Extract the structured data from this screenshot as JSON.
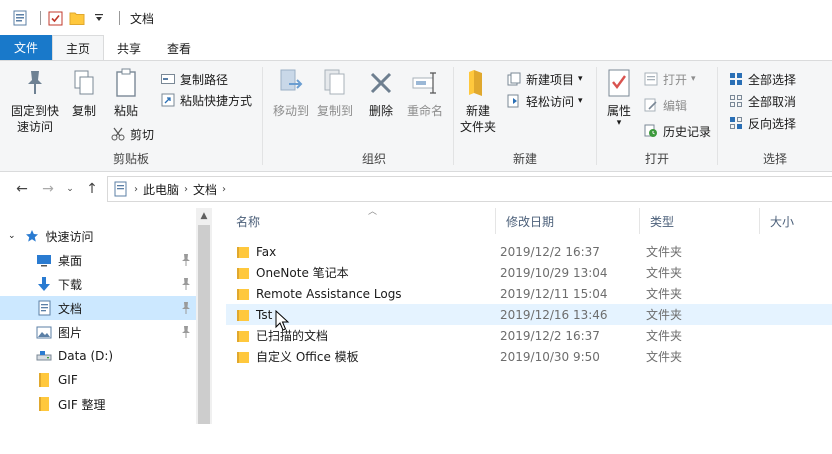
{
  "window": {
    "title": "文档"
  },
  "ribbon_tabs": [
    "文件",
    "主页",
    "共享",
    "查看"
  ],
  "ribbon": {
    "clipboard": {
      "label": "剪贴板",
      "pin_quick_access": "固定到快\n速访问",
      "copy": "复制",
      "paste": "粘贴",
      "copy_path": "复制路径",
      "paste_shortcut": "粘贴快捷方式",
      "cut": "剪切"
    },
    "organize": {
      "label": "组织",
      "move_to": "移动到",
      "copy_to": "复制到",
      "delete": "删除",
      "rename": "重命名"
    },
    "new": {
      "label": "新建",
      "new_folder": "新建\n文件夹",
      "new_item": "新建项目",
      "easy_access": "轻松访问"
    },
    "open": {
      "label": "打开",
      "properties": "属性",
      "open": "打开",
      "edit": "编辑",
      "history": "历史记录"
    },
    "select": {
      "label": "选择",
      "select_all": "全部选择",
      "select_none": "全部取消",
      "invert": "反向选择"
    }
  },
  "address": {
    "crumbs": [
      "此电脑",
      "文档"
    ]
  },
  "nav_pane": {
    "items": [
      {
        "label": "快速访问",
        "icon": "star-icon"
      },
      {
        "label": "桌面",
        "icon": "desktop-icon"
      },
      {
        "label": "下载",
        "icon": "download-icon"
      },
      {
        "label": "文档",
        "icon": "document-icon"
      },
      {
        "label": "图片",
        "icon": "picture-icon"
      },
      {
        "label": "Data (D:)",
        "icon": "drive-icon"
      },
      {
        "label": "GIF",
        "icon": "folder-icon"
      },
      {
        "label": "GIF 整理",
        "icon": "folder-icon"
      }
    ]
  },
  "file_list": {
    "columns": [
      "名称",
      "修改日期",
      "类型",
      "大小"
    ],
    "rows": [
      {
        "name": "Fax",
        "date": "2019/12/2 16:37",
        "type": "文件夹"
      },
      {
        "name": "OneNote 笔记本",
        "date": "2019/10/29 13:04",
        "type": "文件夹"
      },
      {
        "name": "Remote Assistance Logs",
        "date": "2019/12/11 15:04",
        "type": "文件夹"
      },
      {
        "name": "Tst",
        "date": "2019/12/16 13:46",
        "type": "文件夹"
      },
      {
        "name": "已扫描的文档",
        "date": "2019/12/2 16:37",
        "type": "文件夹"
      },
      {
        "name": "自定义 Office 模板",
        "date": "2019/10/30 9:50",
        "type": "文件夹"
      }
    ]
  },
  "colors": {
    "file_tab": "#1979ca",
    "selected": "#cce8ff",
    "hover": "#e5f3ff",
    "folder": "#ffc83d"
  }
}
